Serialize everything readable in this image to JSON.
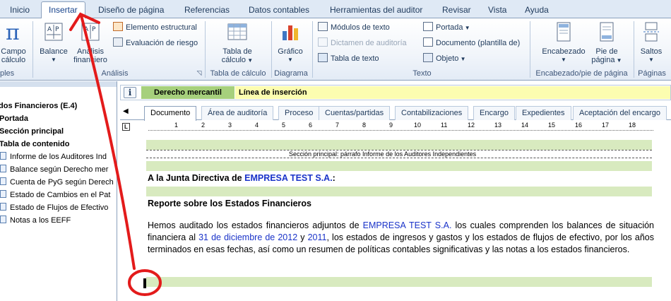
{
  "ribbon_tabs": [
    "Inicio",
    "Insertar",
    "Diseño de página",
    "Referencias",
    "Datos contables",
    "Herramientas del auditor",
    "Revisar",
    "Vista",
    "Ayuda"
  ],
  "active_tab": "Insertar",
  "ribbon": {
    "campo_calculo": "Campo de cálculo",
    "campo_calculo_line2": "cálculo",
    "group_partial": "ples",
    "balance": "Balance",
    "analisis": "Análisis",
    "analisis_line2": "financiero",
    "elemento_estructural": "Elemento estructural",
    "evaluacion_riesgo": "Evaluación de riesgo",
    "group_analisis": "Análisis",
    "tabla_calculo_line1": "Tabla de",
    "tabla_calculo_line2": "cálculo",
    "group_tabla_calculo": "Tabla de cálculo",
    "grafico": "Gráfico",
    "group_diagrama": "Diagrama",
    "modulos_texto": "Módulos de texto",
    "dictamen": "Dictamen de auditoría",
    "tabla_texto": "Tabla de texto",
    "portada": "Portada",
    "documento_plantilla": "Documento (plantilla de)",
    "objeto": "Objeto",
    "group_texto": "Texto",
    "encabezado": "Encabezado",
    "pie_line1": "Pie de",
    "pie_line2": "página",
    "group_encabezado": "Encabezado/pie de página",
    "saltos": "Saltos",
    "group_paginas": "Páginas"
  },
  "nav": {
    "items": [
      {
        "label": "dos Financieros (E.4)",
        "bold": true,
        "icon": false
      },
      {
        "label": "Portada",
        "bold": true,
        "icon": false
      },
      {
        "label": "Sección principal",
        "bold": true,
        "icon": false
      },
      {
        "label": "Tabla de contenido",
        "bold": true,
        "icon": false
      },
      {
        "label": "Informe de los Auditores Ind",
        "bold": false,
        "icon": true
      },
      {
        "label": "Balance según Derecho mer",
        "bold": false,
        "icon": true
      },
      {
        "label": "Cuenta de PyG según Derech",
        "bold": false,
        "icon": true
      },
      {
        "label": "Estado de Cambios en el Pat",
        "bold": false,
        "icon": true
      },
      {
        "label": "Estado de Flujos de Efectivo",
        "bold": false,
        "icon": true
      },
      {
        "label": "Notas a los EEFF",
        "bold": false,
        "icon": true
      }
    ]
  },
  "infobar": {
    "area": "Derecho mercantil",
    "line": "Línea de inserción"
  },
  "doc_tabs": [
    "Documento",
    "Área de auditoría",
    "Proceso",
    "Cuentas/partidas",
    "Contabilizaciones",
    "Encargo",
    "Expedientes",
    "Aceptación del encargo"
  ],
  "active_doc_tab": "Documento",
  "ruler_numbers": [
    "1",
    "2",
    "3",
    "4",
    "5",
    "6",
    "7",
    "8",
    "9",
    "10",
    "11",
    "12",
    "13",
    "14",
    "15",
    "16",
    "17",
    "18"
  ],
  "document": {
    "section_label": "Sección principal: párrafo Informe de los Auditores Independientes",
    "greeting_prefix": "A la Junta Directiva de",
    "company": "EMPRESA TEST S.A.",
    "greeting_suffix": ":",
    "heading": "Reporte sobre los Estados Financieros",
    "para_1": "Hemos auditado los estados financieros adjuntos de",
    "para_company": "EMPRESA TEST S.A.",
    "para_2": " los cuales comprenden los balances de situación financiera al",
    "para_date": "31 de diciembre de 2012",
    "para_3": "y",
    "para_year": "2011",
    "para_4": ", los estados de ingresos y gastos y los estados de flujos de efectivo, por los años terminados en esas fechas, así como un resumen de políticas contables significativas y las notas a los estados financieros."
  },
  "colors": {
    "annotation_red": "#e31b1b",
    "field_blue": "#1a33c9",
    "area_green": "#a6d07c",
    "line_yellow": "#fcfdb0"
  }
}
